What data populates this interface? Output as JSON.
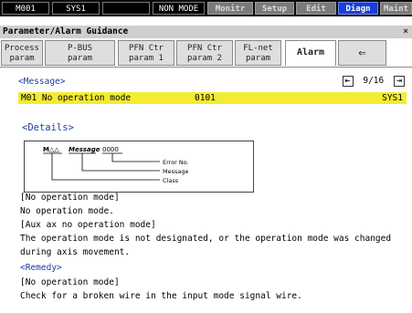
{
  "topbar": {
    "items": [
      {
        "label": "M001",
        "kind": "normal"
      },
      {
        "label": "SYS1",
        "kind": "normal"
      },
      {
        "label": "",
        "kind": "normal"
      },
      {
        "label": "NON MODE",
        "kind": "normal"
      },
      {
        "label": "Monitr",
        "kind": "mode"
      },
      {
        "label": "Setup",
        "kind": "mode"
      },
      {
        "label": "Edit",
        "kind": "mode"
      },
      {
        "label": "Diagn",
        "kind": "active"
      },
      {
        "label": "Maint",
        "kind": "mode"
      }
    ]
  },
  "titlebar": {
    "title": "Parameter/Alarm Guidance",
    "close": "×"
  },
  "tabs": [
    {
      "line1": "Process",
      "line2": "param"
    },
    {
      "line1": "P-BUS",
      "line2": "param"
    },
    {
      "line1": "PFN Ctr",
      "line2": "param 1"
    },
    {
      "line1": "PFN Ctr",
      "line2": "param 2"
    },
    {
      "line1": "FL-net",
      "line2": "param"
    },
    {
      "line1": "Alarm",
      "line2": ""
    },
    {
      "line1": "⇐",
      "line2": ""
    }
  ],
  "message": {
    "header": "<Message>",
    "page": "9/16",
    "prev_icon": "⇤",
    "next_icon": "⇥",
    "row": {
      "code": "M01 No operation mode",
      "number": "0101",
      "system": "SYS1"
    }
  },
  "details": {
    "header": "<Details>",
    "diagram": {
      "format": "M△△",
      "message_word": "Message",
      "digits": "0000",
      "labels": [
        "Error No.",
        "Message",
        "Class"
      ]
    }
  },
  "lines": [
    {
      "text": "[No operation mode]",
      "style": "normal"
    },
    {
      "text": "No operation mode.",
      "style": "normal"
    },
    {
      "text": "[Aux ax no operation mode]",
      "style": "normal"
    },
    {
      "text": "The operation mode is not designated, or the operation mode was changed",
      "style": "normal"
    },
    {
      "text": "during axis movement.",
      "style": "normal"
    },
    {
      "text": "<Remedy>",
      "style": "hdr"
    },
    {
      "text": "[No operation mode]",
      "style": "normal"
    },
    {
      "text": " Check for a broken wire in the input mode signal wire.",
      "style": "normal"
    }
  ]
}
